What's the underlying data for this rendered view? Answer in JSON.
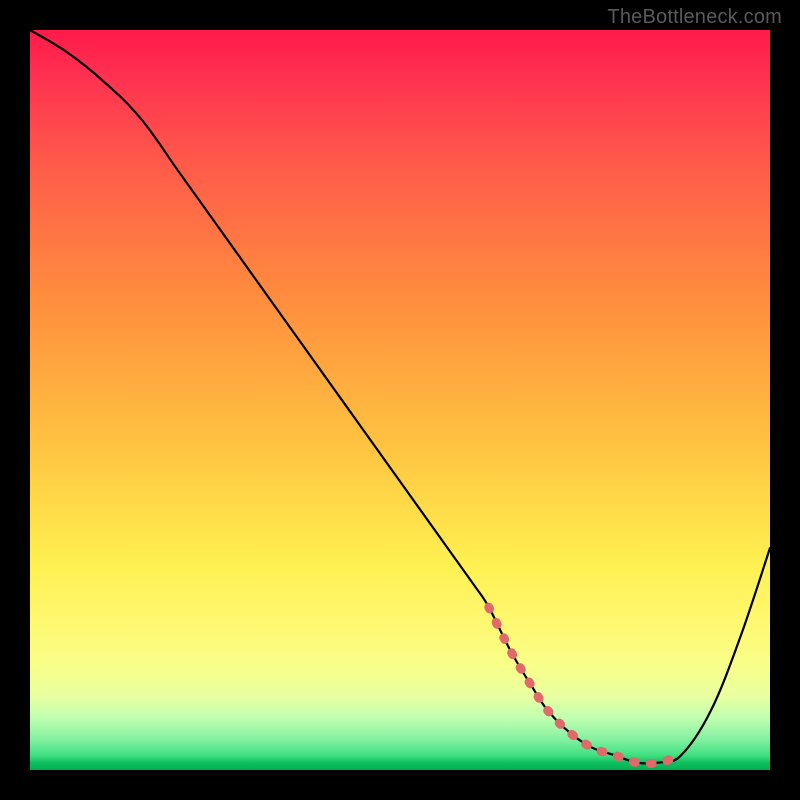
{
  "attribution": "TheBottleneck.com",
  "colors": {
    "curve": "#000000",
    "dash": "#e06a6a",
    "background_top": "#ff1a4a",
    "background_bottom": "#00b050"
  },
  "chart_data": {
    "type": "line",
    "title": "",
    "xlabel": "",
    "ylabel": "",
    "xlim": [
      0,
      100
    ],
    "ylim": [
      0,
      100
    ],
    "x": [
      0,
      5,
      10,
      15,
      20,
      25,
      30,
      35,
      40,
      45,
      50,
      55,
      60,
      62,
      65,
      68,
      70,
      73,
      76,
      79,
      82,
      85,
      88,
      92,
      96,
      100
    ],
    "values": [
      100,
      97,
      93,
      88,
      81,
      74,
      67,
      60,
      53,
      46,
      39,
      32,
      25,
      22,
      16,
      11,
      8,
      5,
      3,
      2,
      1,
      1,
      2,
      8,
      18,
      30
    ],
    "dash_segment_x": [
      62,
      88
    ],
    "dash_segment_values": [
      22,
      2
    ]
  }
}
